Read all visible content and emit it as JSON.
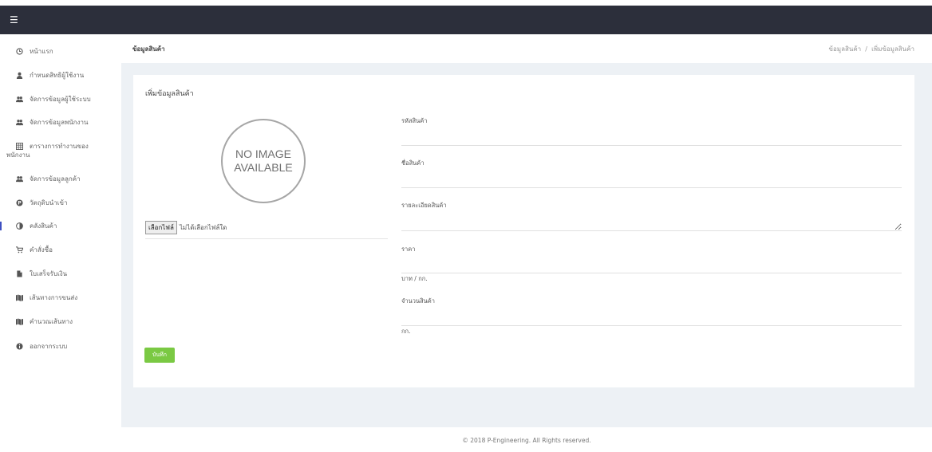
{
  "topbar": {
    "menu_icon": "hamburger-icon"
  },
  "sidebar": {
    "items": [
      {
        "label": "หน้าแรก",
        "icon": "clock-icon"
      },
      {
        "label": "กำหนดสิทธิผู้ใช้งาน",
        "icon": "user-icon"
      },
      {
        "label": "จัดการข้อมูลผู้ใช้ระบบ",
        "icon": "users-icon"
      },
      {
        "label": "จัดการข้อมูลพนักงาน",
        "icon": "users-icon"
      },
      {
        "label": "ตารางการทำงานของพนักงาน",
        "icon": "table-icon"
      },
      {
        "label": "จัดการข้อมูลลูกค้า",
        "icon": "users-icon"
      },
      {
        "label": "วัตถุดิบนำเข้า",
        "icon": "parking-icon"
      },
      {
        "label": "คลังสินค้า",
        "icon": "pie-chart-icon"
      },
      {
        "label": "คำสั่งซื้อ",
        "icon": "cart-icon"
      },
      {
        "label": "ใบเสร็จรับเงิน",
        "icon": "file-icon"
      },
      {
        "label": "เส้นทางการขนส่ง",
        "icon": "map-icon"
      },
      {
        "label": "คำนวณเส้นทาง",
        "icon": "map-icon"
      },
      {
        "label": "ออกจากระบบ",
        "icon": "info-icon"
      }
    ],
    "active_index": 7
  },
  "header": {
    "page_title": "ข้อมูลสินค้า",
    "breadcrumb": [
      "ข้อมูลสินค้า",
      "/",
      "เพิ่มข้อมูลสินค้า"
    ]
  },
  "form": {
    "title": "เพิ่มข้อมูลสินค้า",
    "image_placeholder": [
      "NO IMAGE",
      "AVAILABLE"
    ],
    "file_button": "เลือกไฟล์",
    "file_status": "ไม่ได้เลือกไฟล์ใด",
    "save_button": "บันทึก",
    "fields": {
      "code": {
        "label": "รหัสสินค้า",
        "value": ""
      },
      "name": {
        "label": "ชื่อสินค้า",
        "value": ""
      },
      "detail": {
        "label": "รายละเอียดสินค้า",
        "value": ""
      },
      "price": {
        "label": "ราคา",
        "value": "",
        "unit": "บาท / กก."
      },
      "quantity": {
        "label": "จำนวนสินค้า",
        "value": "",
        "unit": "กก."
      }
    }
  },
  "footer": {
    "text": "© 2018 P-Engineering. All Rights reserved."
  }
}
